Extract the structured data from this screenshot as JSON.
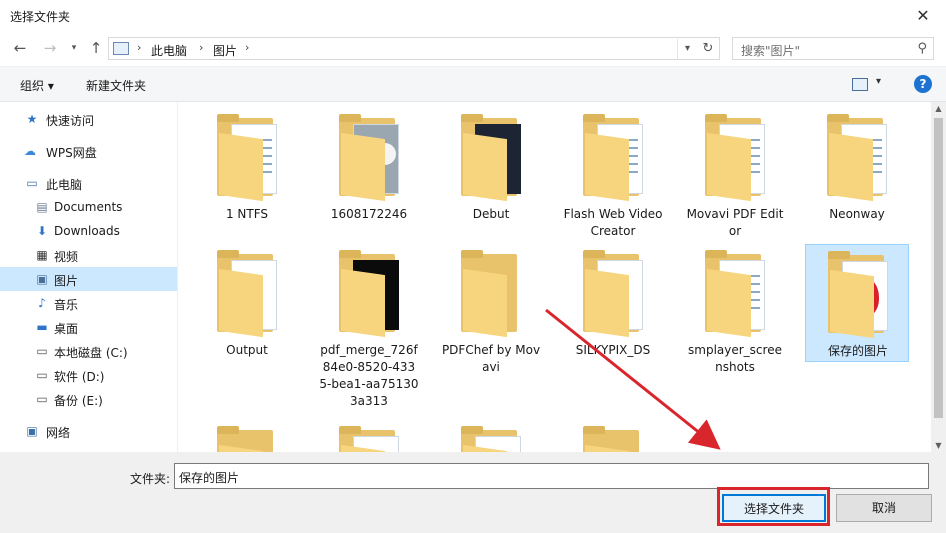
{
  "window": {
    "title": "选择文件夹",
    "close_glyph": "✕"
  },
  "nav": {
    "breadcrumb": [
      "此电脑",
      "图片"
    ],
    "search_placeholder": "搜索\"图片\""
  },
  "toolbar": {
    "organize": "组织 ▾",
    "new_folder": "新建文件夹",
    "help": "?"
  },
  "sidebar": {
    "items": [
      {
        "label": "快速访问",
        "icon": "star-icon"
      },
      {
        "label": "WPS网盘",
        "icon": "cloud-icon"
      },
      {
        "label": "此电脑",
        "icon": "computer-icon"
      },
      {
        "label": "Documents",
        "icon": "document-icon"
      },
      {
        "label": "Downloads",
        "icon": "download-icon"
      },
      {
        "label": "视频",
        "icon": "video-icon"
      },
      {
        "label": "图片",
        "icon": "picture-icon",
        "selected": true
      },
      {
        "label": "音乐",
        "icon": "music-icon"
      },
      {
        "label": "桌面",
        "icon": "desktop-icon"
      },
      {
        "label": "本地磁盘 (C:)",
        "icon": "drive-icon"
      },
      {
        "label": "软件 (D:)",
        "icon": "drive-icon"
      },
      {
        "label": "备份 (E:)",
        "icon": "drive-icon"
      },
      {
        "label": "网络",
        "icon": "network-icon"
      }
    ]
  },
  "folders": [
    {
      "name": "1 NTFS",
      "thumb": "doc"
    },
    {
      "name": "1608172246",
      "thumb": "photo"
    },
    {
      "name": "Debut",
      "thumb": "dark"
    },
    {
      "name": "Flash Web Video Creator",
      "thumb": "doc"
    },
    {
      "name": "Movavi PDF Editor",
      "thumb": "doc"
    },
    {
      "name": "Neonway",
      "thumb": "doc"
    },
    {
      "name": "Output",
      "thumb": "file"
    },
    {
      "name": "pdf_merge_726f84e0-8520-4335-bea1-aa751303a313",
      "thumb": "black"
    },
    {
      "name": "PDFChef by Movavi",
      "thumb": "plain"
    },
    {
      "name": "SILKYPIX_DS",
      "thumb": "file"
    },
    {
      "name": "smplayer_screenshots",
      "thumb": "doc"
    },
    {
      "name": "保存的图片",
      "thumb": "strawberry",
      "selected": true
    },
    {
      "name": "",
      "thumb": "plain"
    },
    {
      "name": "",
      "thumb": "strawberry"
    },
    {
      "name": "",
      "thumb": "strawberry"
    },
    {
      "name": "",
      "thumb": "plain"
    }
  ],
  "footer": {
    "folder_label": "文件夹:",
    "folder_value": "保存的图片",
    "select_button": "选择文件夹",
    "cancel_button": "取消"
  },
  "colors": {
    "highlight": "#d9262c",
    "selection": "#cce8ff",
    "accent": "#0078d7",
    "folder": "#f7d57e"
  }
}
